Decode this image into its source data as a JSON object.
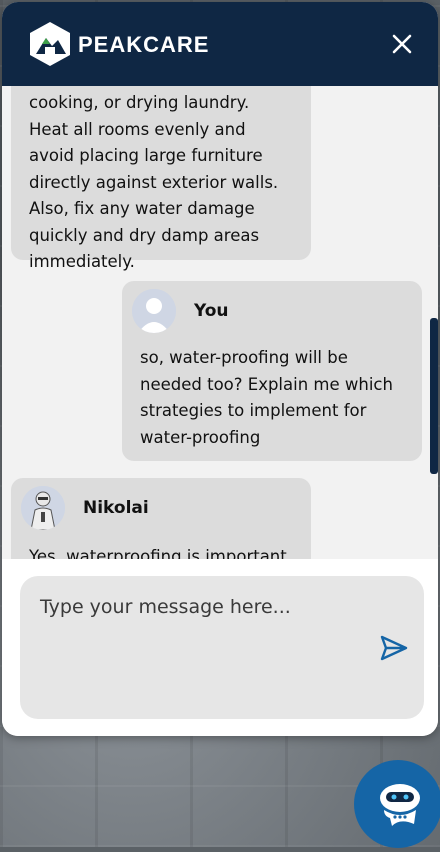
{
  "header": {
    "brand": "PEAKCARE"
  },
  "messages": [
    {
      "sender": "",
      "text": "cooking, or drying laundry. Heat all rooms evenly and avoid placing large furniture directly against exterior walls. Also, fix any water damage quickly and dry damp areas immediately."
    },
    {
      "sender": "You",
      "text": "so, water-proofing will be needed too? Explain me which strategies to implement for water-proofing"
    },
    {
      "sender": "Nikolai",
      "text": "Yes, waterproofing is important"
    }
  ],
  "composer": {
    "placeholder": "Type your message here..."
  },
  "colors": {
    "header": "#0f2744",
    "bubble": "#dcdcdc",
    "accent": "#1565a6"
  },
  "icons": {
    "close": "close-icon",
    "send": "send-icon",
    "launcher": "chatbot-icon"
  }
}
